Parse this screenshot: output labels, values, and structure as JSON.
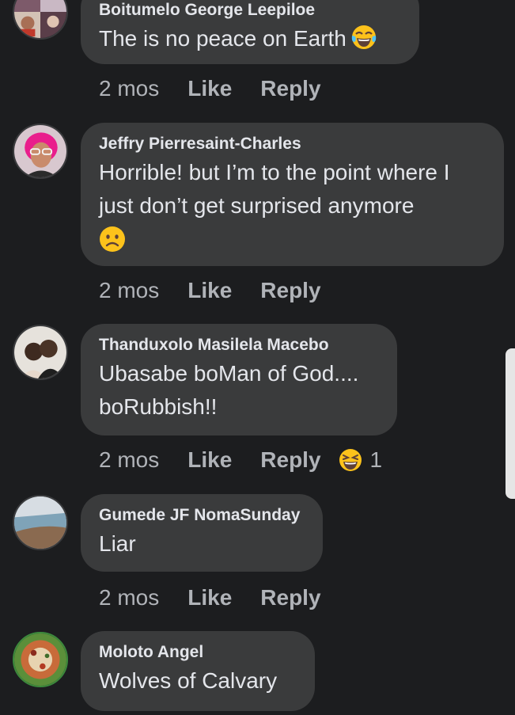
{
  "comments": [
    {
      "author": "Boitumelo George Leepiloe",
      "text": "The is no peace on Earth",
      "emoji": "tears-of-joy-emoji",
      "time": "2 mos",
      "like": "Like",
      "reply": "Reply"
    },
    {
      "author": "Jeffry Pierresaint-Charles",
      "text": "Horrible! but I’m to the point where I just don’t get surprised anymore",
      "emoji": "frowning-face-emoji",
      "time": "2 mos",
      "like": "Like",
      "reply": "Reply"
    },
    {
      "author": "Thanduxolo Masilela Macebo",
      "text": "Ubasabe boMan of God.... boRubbish!!",
      "time": "2 mos",
      "like": "Like",
      "reply": "Reply",
      "reaction": {
        "icon": "haha-reaction-icon",
        "count": "1"
      }
    },
    {
      "author": "Gumede JF NomaSunday",
      "text": "Liar",
      "time": "2 mos",
      "like": "Like",
      "reply": "Reply"
    },
    {
      "author": "Moloto Angel",
      "text": "Wolves of Calvary"
    }
  ],
  "colors": {
    "background": "#1c1d1f",
    "bubble": "#3a3b3c",
    "text_primary": "#e4e6eb",
    "text_secondary": "#b0b3b8",
    "emoji_yellow": "#fcc21b"
  }
}
